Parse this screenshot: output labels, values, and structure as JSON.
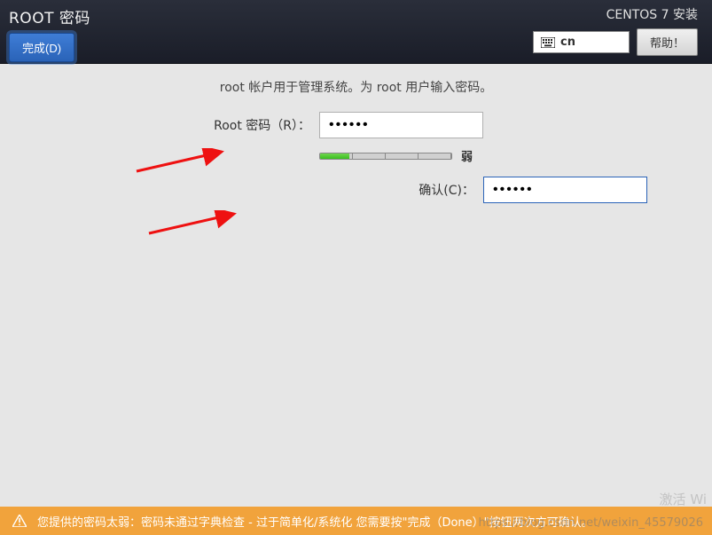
{
  "header": {
    "page_title": "ROOT 密码",
    "done_button": "完成(D)",
    "installer_title": "CENTOS 7 安装",
    "lang_code": "cn",
    "help_button": "帮助！"
  },
  "form": {
    "instruction": "root 帐户用于管理系统。为 root 用户输入密码。",
    "password_label": "Root 密码（R）：",
    "confirm_label": "确认(C)：",
    "password_value": "••••••",
    "confirm_value": "••••••",
    "strength_label": "弱",
    "strength_percent": 22
  },
  "warning": {
    "message": "您提供的密码太弱：密码未通过字典检查 - 过于简单化/系统化 您需要按\"完成（Done）\"按钮两次方可确认。"
  },
  "watermark": {
    "url": "https://blog.csdn.net/weixin_45579026",
    "activate": "激活 Wi"
  }
}
